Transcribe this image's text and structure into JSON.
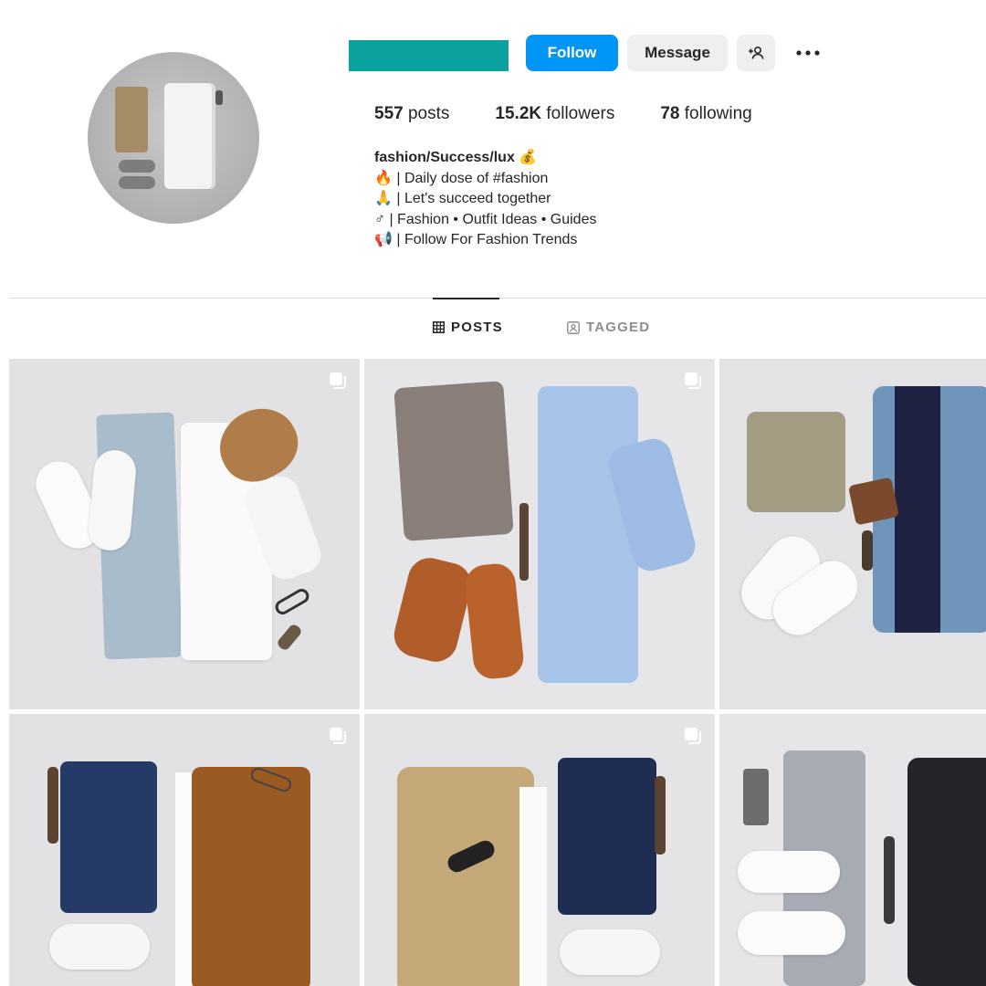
{
  "header": {
    "follow_label": "Follow",
    "message_label": "Message",
    "add_user_icon": "add-user-icon",
    "more_icon": "more-options-icon",
    "username_color": "#0aa19e",
    "accent_color": "#0095f6"
  },
  "stats": {
    "posts_count": "557",
    "posts_label": " posts",
    "followers_count": "15.2K",
    "followers_label": " followers",
    "following_count": "78",
    "following_label": " following"
  },
  "bio": {
    "name": "fashion/Success/lux 💰",
    "lines": [
      "🔥 | Daily dose of #fashion",
      "🙏 | Let's succeed together",
      "♂ | Fashion • Outfit Ideas • Guides",
      "📢 | Follow For Fashion Trends"
    ]
  },
  "tabs": {
    "posts_label": "POSTS",
    "tagged_label": "TAGGED",
    "active": "posts"
  },
  "posts": [
    {
      "description": "flatlay-light-jeans-white-shirt-cap",
      "multi": true
    },
    {
      "description": "flatlay-grey-chinos-blue-shirt-boots",
      "multi": true
    },
    {
      "description": "flatlay-olive-chinos-denim-jacket",
      "multi": false
    },
    {
      "description": "flatlay-dark-jeans-corduroy-shirt",
      "multi": true
    },
    {
      "description": "flatlay-khaki-jacket-dark-jeans",
      "multi": true
    },
    {
      "description": "flatlay-grey-chinos-navy-sweater",
      "multi": false
    }
  ]
}
